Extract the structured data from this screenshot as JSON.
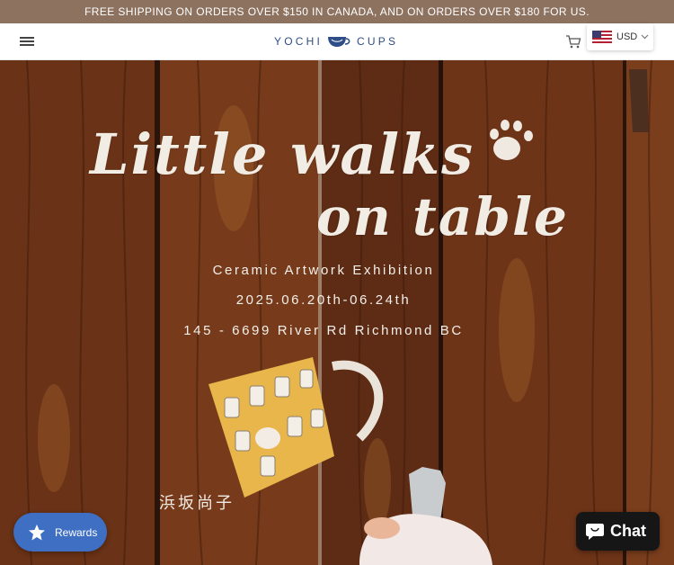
{
  "announcement": "FREE SHIPPING ON ORDERS OVER $150 IN CANADA, AND ON ORDERS OVER $180 FOR US.",
  "header": {
    "logo_left": "YOCHI",
    "logo_right": "CUPS",
    "currency": "USD"
  },
  "hero": {
    "title_line1": "Little walks",
    "title_line2": "on table",
    "subtitle": "Ceramic Artwork Exhibition",
    "dates": "2025.06.20th-06.24th",
    "address": "145 - 6699 River Rd Richmond BC",
    "artist": "浜坂尚子"
  },
  "widgets": {
    "rewards_label": "Rewards",
    "chat_label": "Chat"
  },
  "colors": {
    "announcement_bg": "#8d7260",
    "logo": "#2e4e87",
    "rewards_bg": "#3f6fc2",
    "chat_bg": "#161616"
  }
}
